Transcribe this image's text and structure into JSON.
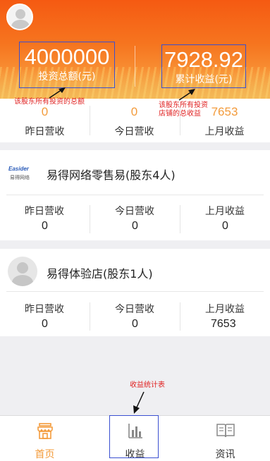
{
  "header": {
    "total_investment": "4000000",
    "total_investment_label": "投资总额(元)",
    "cumulative_income": "7928.92",
    "cumulative_income_label": "累计收益(元)"
  },
  "annotations": {
    "investment_note": "该股东所有投资的总额",
    "income_note_line1": "该股东所有投资",
    "income_note_line2": "店铺的总收益",
    "tab_note": "收益统计表"
  },
  "summary": {
    "yesterday_value": "0",
    "yesterday_label": "昨日营收",
    "today_value": "0",
    "today_label": "今日营收",
    "last_month_value": "7653",
    "last_month_label": "上月收益"
  },
  "shops": [
    {
      "name": "易得网络零售易(股东4人)",
      "logo_text_1": "Easider",
      "logo_text_2": "易得网络",
      "yesterday_label": "昨日营收",
      "yesterday_value": "0",
      "today_label": "今日营收",
      "today_value": "0",
      "last_month_label": "上月收益",
      "last_month_value": "0"
    },
    {
      "name": "易得体验店(股东1人)",
      "yesterday_label": "昨日营收",
      "yesterday_value": "0",
      "today_label": "今日营收",
      "today_value": "0",
      "last_month_label": "上月收益",
      "last_month_value": "7653"
    }
  ],
  "tabbar": {
    "home_label": "首页",
    "income_label": "收益",
    "news_label": "资讯",
    "active_color": "#f39b3b"
  },
  "icons": {
    "home": "storefront-icon",
    "income": "bar-chart-icon",
    "news": "book-icon"
  }
}
